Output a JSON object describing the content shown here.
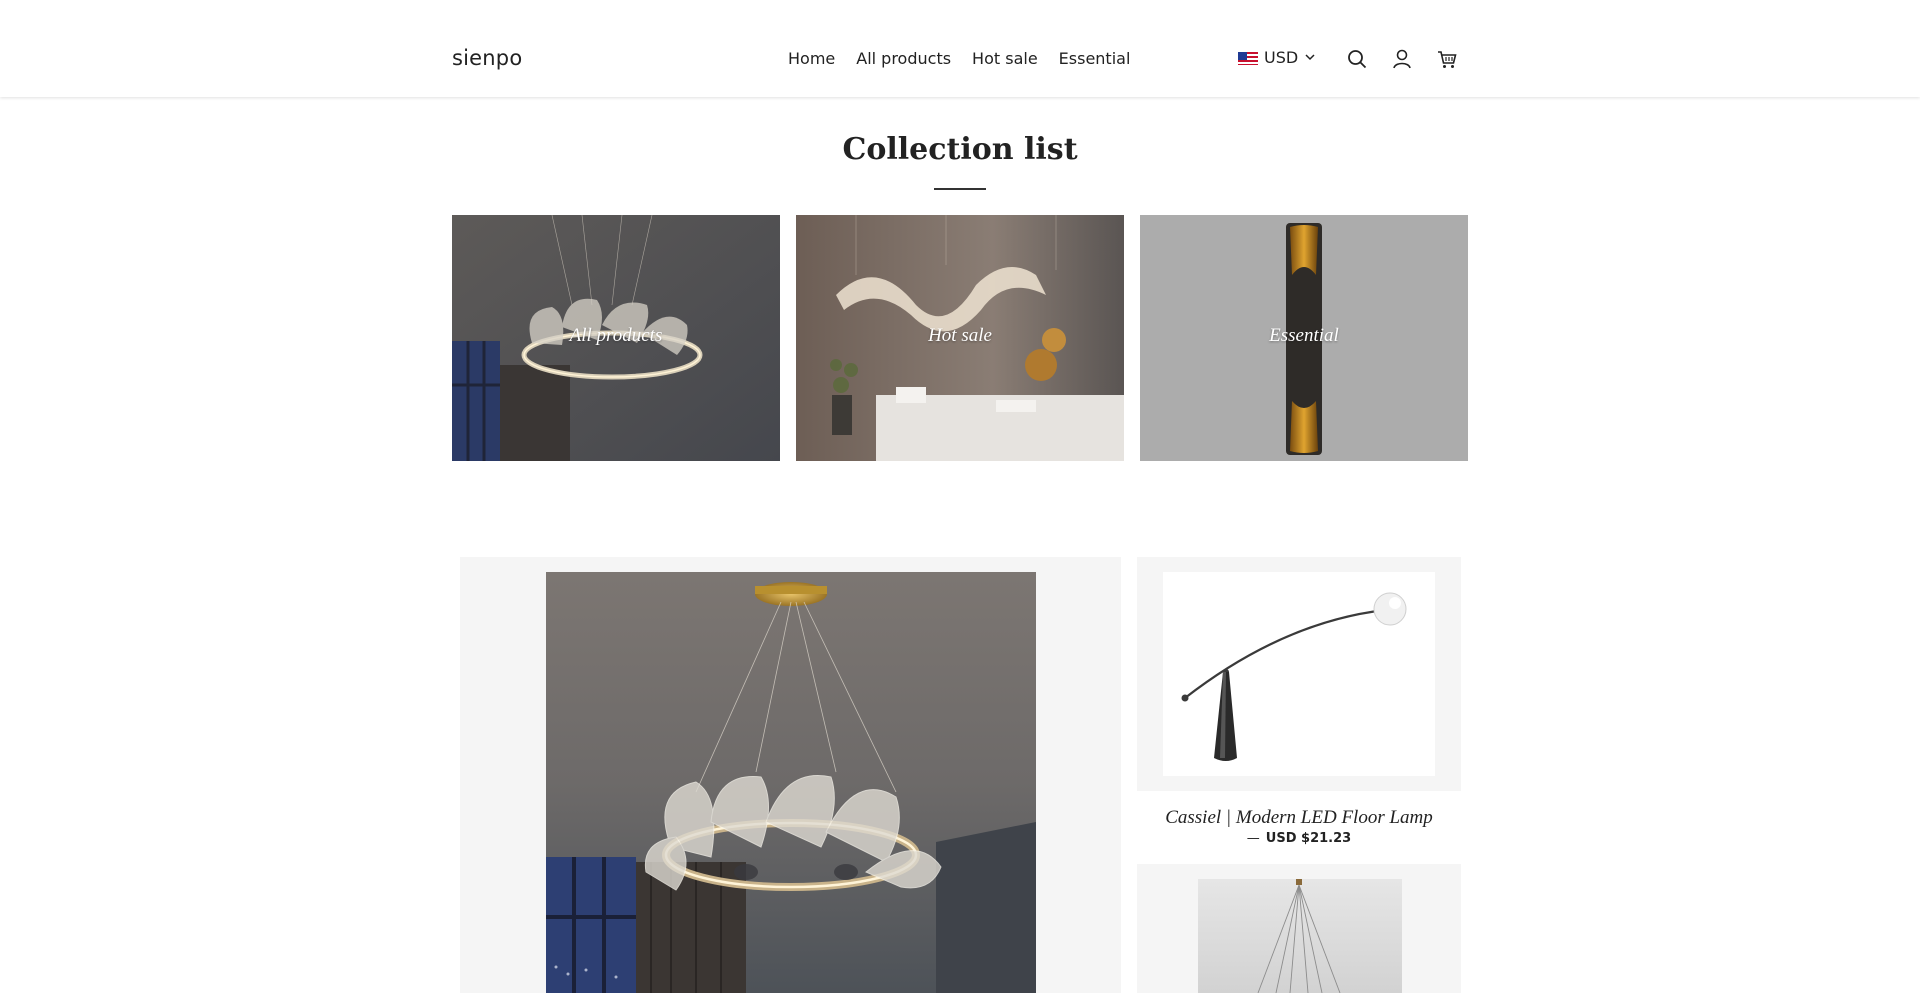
{
  "header": {
    "logo": "sienpo",
    "nav": [
      {
        "label": "Home"
      },
      {
        "label": "All products"
      },
      {
        "label": "Hot sale"
      },
      {
        "label": "Essential"
      }
    ],
    "currency": "USD",
    "icons": [
      "us-flag-icon",
      "chevron-down-icon",
      "search-icon",
      "account-icon",
      "cart-icon"
    ]
  },
  "collection_section": {
    "title": "Collection list",
    "tiles": [
      {
        "label": "All products"
      },
      {
        "label": "Hot sale"
      },
      {
        "label": "Essential"
      }
    ]
  },
  "featured": {
    "products": [
      {
        "title": "Cassiel | Modern LED Floor Lamp",
        "price": "USD $21.23",
        "dash": "—"
      }
    ]
  },
  "colors": {
    "background": "#ffffff",
    "card_background": "#f5f5f5",
    "text": "#222222"
  }
}
